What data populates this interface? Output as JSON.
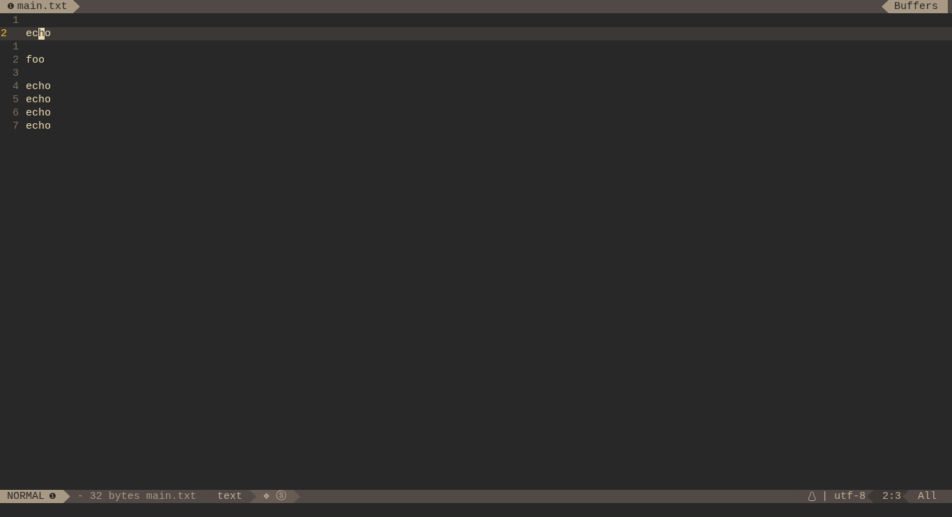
{
  "tabline": {
    "buffer": {
      "mark": "❶",
      "name": "main.txt"
    },
    "right_label": "Buffers"
  },
  "lines": [
    {
      "number": "1",
      "current": false
    },
    {
      "number": "2",
      "before": "ec",
      "cursor": "h",
      "after": "o",
      "current": true
    },
    {
      "number": "1",
      "current": false
    },
    {
      "number": "2",
      "text": "foo",
      "current": false
    },
    {
      "number": "3",
      "current": false
    },
    {
      "number": "4",
      "text": "echo",
      "current": false
    },
    {
      "number": "5",
      "text": "echo",
      "current": false
    },
    {
      "number": "6",
      "text": "echo",
      "current": false
    },
    {
      "number": "7",
      "text": "echo",
      "current": false
    }
  ],
  "status_bar": {
    "left": [
      {
        "kind": "mode",
        "text": "NORMAL",
        "mark": "❶"
      },
      {
        "kind": "text",
        "text": "- 32 bytes main.txt"
      },
      {
        "kind": "text",
        "text": "text"
      },
      {
        "kind": "text",
        "text": "❖ ⓢ"
      }
    ],
    "right": [
      {
        "kind": "os",
        "text": "| utf-8"
      },
      {
        "kind": "text",
        "text": "2:3"
      },
      {
        "kind": "text",
        "text": "All"
      }
    ]
  }
}
